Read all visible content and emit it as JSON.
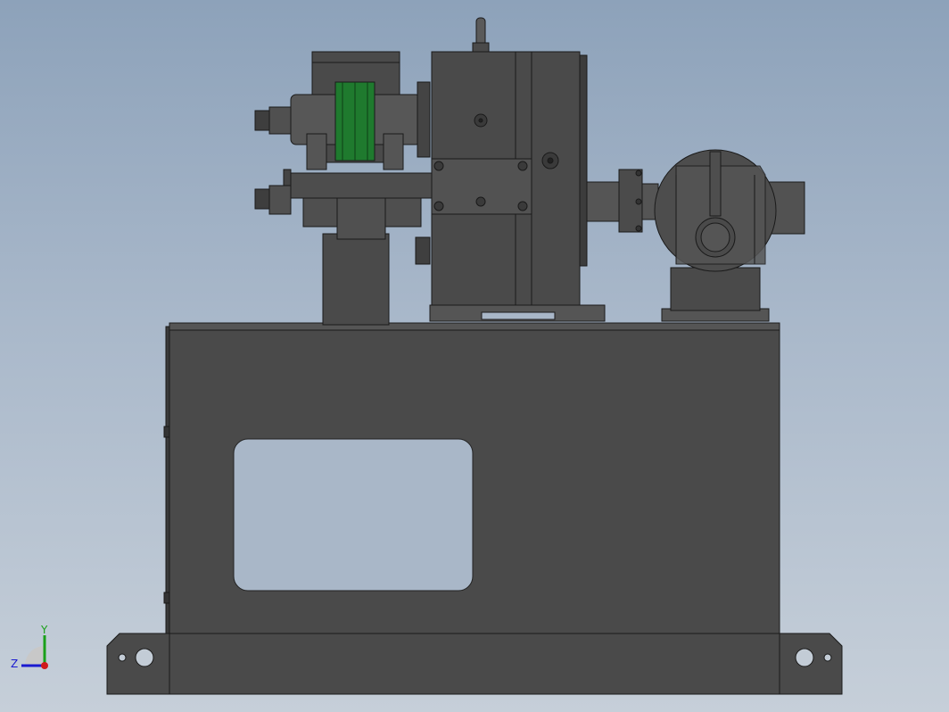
{
  "viewport": {
    "background_top": "#8da2ba",
    "background_bottom": "#c6cfd9",
    "part_fill": "#4a4a4a",
    "edge_color": "#1a1a1a",
    "accent_green": "#1f7a2e"
  },
  "triad": {
    "x_label": "",
    "y_label": "Y",
    "z_label": "Z",
    "y_color": "#1aa01a",
    "z_color": "#1a1ad0",
    "x_color": "#d01a1a"
  }
}
